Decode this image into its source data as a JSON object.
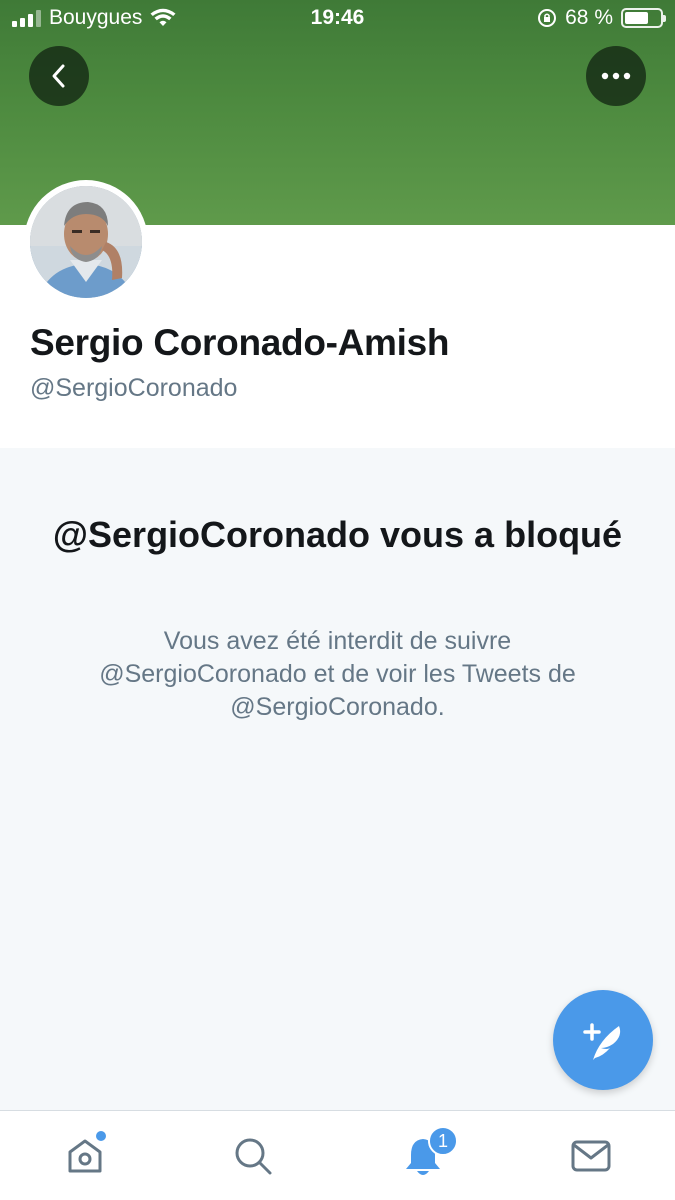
{
  "status_bar": {
    "carrier": "Bouygues",
    "time": "19:46",
    "battery": "68 %",
    "battery_level": 0.68
  },
  "header": {
    "back_icon": "chevron-left-icon",
    "more_icon": "more-horizontal-icon",
    "banner_color": "#4d8a3f"
  },
  "profile": {
    "name": "Sergio Coronado-Amish",
    "handle": "@SergioCoronado"
  },
  "blocked": {
    "title": "@SergioCoronado vous a bloqué",
    "description": "Vous avez été interdit de suivre @SergioCoronado et de voir les Tweets de @SergioCoronado."
  },
  "fab": {
    "icon": "compose-tweet-icon",
    "color": "#4a99e9"
  },
  "bottom_nav": {
    "items": [
      {
        "name": "home",
        "icon": "home-icon"
      },
      {
        "name": "search",
        "icon": "search-icon"
      },
      {
        "name": "notifications",
        "icon": "bell-icon",
        "badge": "1"
      },
      {
        "name": "messages",
        "icon": "mail-icon"
      }
    ]
  },
  "accent_color": "#4a99e9"
}
